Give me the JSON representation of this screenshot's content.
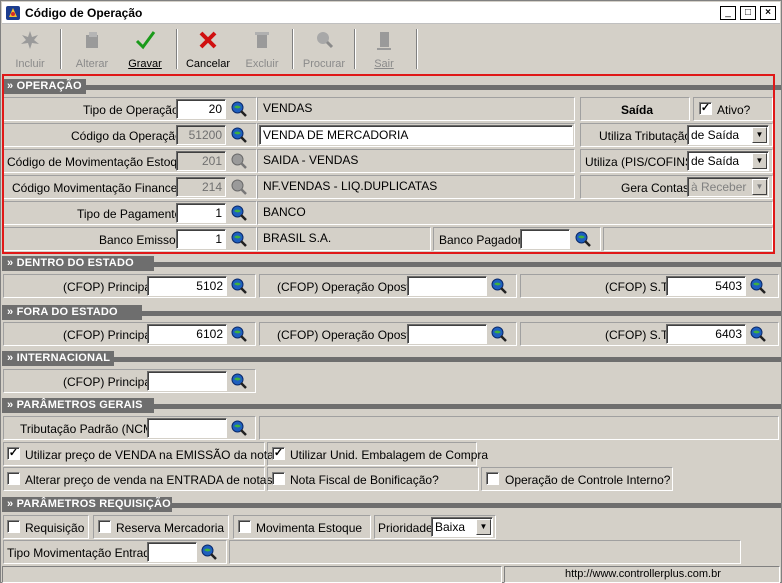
{
  "window": {
    "title": "Código de Operação"
  },
  "toolbar": {
    "incluir": "Incluir",
    "alterar": "Alterar",
    "gravar": "Gravar",
    "cancelar": "Cancelar",
    "excluir": "Excluir",
    "procurar": "Procurar",
    "sair": "Sair"
  },
  "sections": {
    "operacao": "» OPERAÇÃO",
    "dentro": "» DENTRO DO ESTADO",
    "fora": "» FORA DO ESTADO",
    "internacional": "» INTERNACIONAL",
    "parametros": "» PARÂMETROS GERAIS",
    "requisicao": "» PARÂMETROS REQUISIÇÃO"
  },
  "operacao": {
    "tipo_label": "Tipo de Operação",
    "tipo_value": "20",
    "tipo_desc": "VENDAS",
    "saida": "Saída",
    "ativo_label": "Ativo?",
    "ativo_checked": "✓",
    "codigo_label": "Código da Operação",
    "codigo_value": "51200",
    "codigo_desc": "VENDA DE MERCADORIA",
    "utiliza_trib_label": "Utiliza Tributação",
    "utiliza_trib_value": "de Saída",
    "mov_estoque_label": "Código de Movimentação Estoque",
    "mov_estoque_value": "201",
    "mov_estoque_desc": "SAIDA - VENDAS",
    "pis_label": "Utiliza (PIS/COFINS)",
    "pis_value": "de Saída",
    "mov_fin_label": "Código Movimentação Financeira",
    "mov_fin_value": "214",
    "mov_fin_desc": "NF.VENDAS - LIQ.DUPLICATAS",
    "gera_contas_label": "Gera Contas",
    "gera_contas_value": "à Receber",
    "tipo_pag_label": "Tipo de Pagamento",
    "tipo_pag_value": "1",
    "tipo_pag_desc": "BANCO",
    "banco_emissor_label": "Banco Emissor",
    "banco_emissor_value": "1",
    "banco_emissor_desc": "BRASIL S.A.",
    "banco_pagador_label": "Banco Pagador",
    "banco_pagador_value": ""
  },
  "dentro": {
    "principal_label": "(CFOP) Principal",
    "principal_value": "5102",
    "oposta_label": "(CFOP) Operação Oposta",
    "oposta_value": "",
    "st_label": "(CFOP) S.T",
    "st_value": "5403"
  },
  "fora": {
    "principal_label": "(CFOP) Principal",
    "principal_value": "6102",
    "oposta_label": "(CFOP) Operação Oposta",
    "oposta_value": "",
    "st_label": "(CFOP) S.T",
    "st_value": "6403"
  },
  "internacional": {
    "principal_label": "(CFOP) Principal",
    "principal_value": ""
  },
  "parametros": {
    "ncm_label": "Tributação Padrão (NCM)",
    "ncm_value": "",
    "preco_emissao_label": "Utilizar preço de VENDA na EMISSÃO da nota?",
    "preco_emissao_checked": "✓",
    "unid_embalagem_label": "Utilizar Unid. Embalagem de Compra",
    "unid_embalagem_checked": "✓",
    "alterar_preco_label": "Alterar preço de venda na ENTRADA de notas?",
    "bonificacao_label": "Nota Fiscal de Bonificação?",
    "controle_interno_label": "Operação de Controle Interno?"
  },
  "requisicao": {
    "requisicao_label": "Requisição",
    "reserva_label": "Reserva Mercadoria",
    "movimenta_label": "Movimenta Estoque",
    "prioridade_label": "Prioridade",
    "prioridade_value": "Baixa",
    "tipo_mov_label": "Tipo Movimentação Entrada",
    "tipo_mov_value": ""
  },
  "status": {
    "url": "http://www.controllerplus.com.br"
  }
}
